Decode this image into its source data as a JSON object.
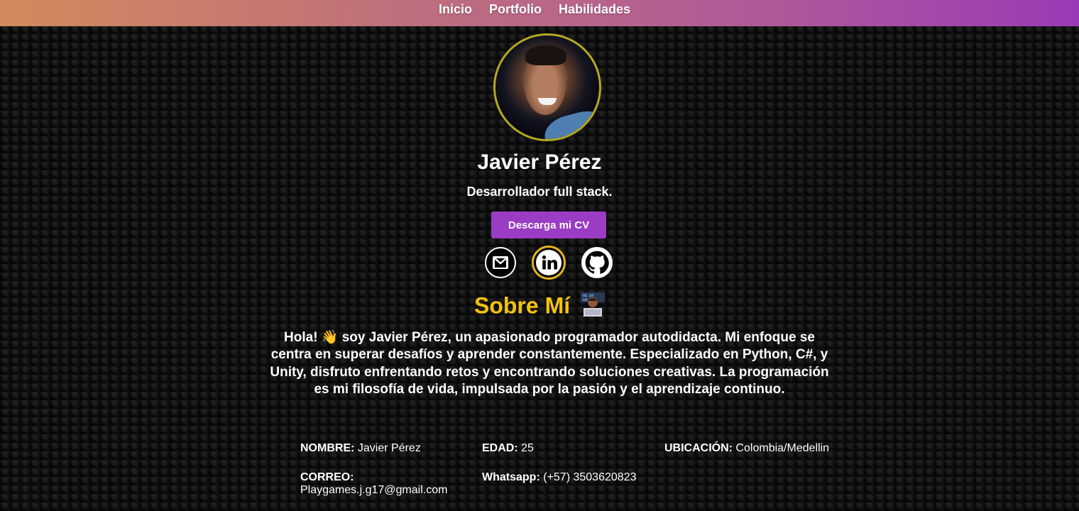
{
  "nav": {
    "items": [
      "Inicio",
      "Portfolio",
      "Habilidades"
    ]
  },
  "profile": {
    "name": "Javier Pérez",
    "role": "Desarrollador full stack.",
    "cv_button": "Descarga mi CV"
  },
  "social": [
    {
      "icon": "gmail-icon"
    },
    {
      "icon": "linkedin-icon"
    },
    {
      "icon": "github-icon"
    }
  ],
  "about": {
    "title": "Sobre Mí",
    "text": "Hola! 👋 soy Javier Pérez, un apasionado programador autodidacta. Mi enfoque se centra en superar desafíos y aprender constantemente. Especializado en Python, C#, y Unity, disfruto enfrentando retos y encontrando soluciones creativas. La programación es mi filosofía de vida, impulsada por la pasión y el aprendizaje continuo."
  },
  "info": {
    "name_label": "NOMBRE:",
    "name_value": "Javier Pérez",
    "age_label": "EDAD:",
    "age_value": "25",
    "location_label": "UBICACIÓN:",
    "location_value": "Colombia/Medellin",
    "email_label": "CORREO:",
    "email_value": "Playgames.j.g17@gmail.com",
    "whatsapp_label": "Whatsapp:",
    "whatsapp_value": "(+57) 3503620823"
  },
  "colors": {
    "accent": "#9b3cc4",
    "title": "#f4c20d",
    "avatar_border": "#b6a722"
  }
}
